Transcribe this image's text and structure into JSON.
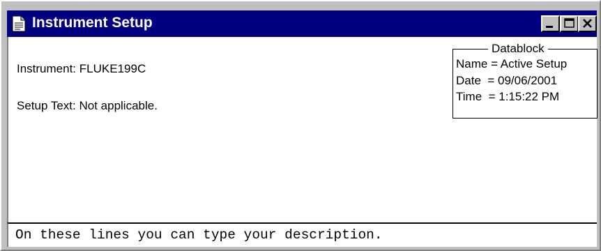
{
  "window": {
    "title": "Instrument Setup",
    "titlebar_color": "#000080",
    "icon": "document-icon",
    "buttons": [
      "minimize-icon",
      "maximize-icon",
      "close-icon"
    ]
  },
  "info": {
    "instrument_label": "Instrument:",
    "instrument_value": "FLUKE199C",
    "setup_text_label": "Setup Text:",
    "setup_text_value": "Not applicable."
  },
  "datablock": {
    "title": "Datablock",
    "name_line": "Name = Active Setup",
    "date_line": "Date  = 09/06/2001",
    "time_line": "Time  = 1:15:22 PM"
  },
  "description": {
    "text": "On these lines you can type your description."
  }
}
